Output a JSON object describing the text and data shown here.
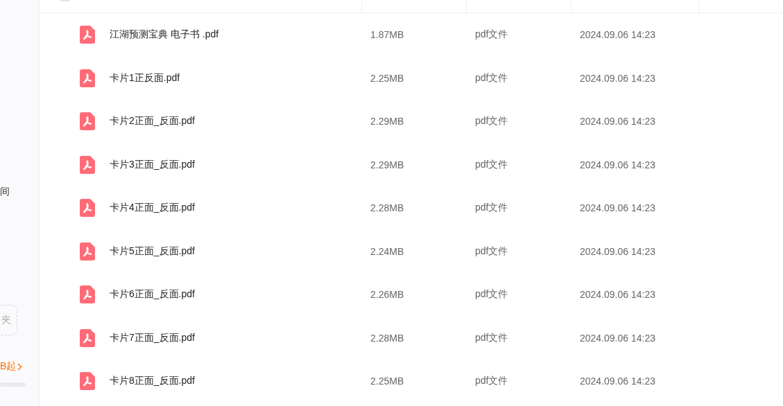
{
  "sidebar": {
    "items": [
      {
        "kind": "text",
        "label": "间"
      },
      {
        "kind": "dashed_button",
        "label": "夹"
      },
      {
        "kind": "link",
        "label": "B起"
      },
      {
        "kind": "meter"
      }
    ]
  },
  "header": {
    "select_all": {
      "checked": false
    }
  },
  "files": [
    {
      "name": "江湖预测宝典 电子书 .pdf",
      "size": "1.87MB",
      "type": "pdf文件",
      "modified": "2024.09.06 14:23"
    },
    {
      "name": "卡片1正反面.pdf",
      "size": "2.25MB",
      "type": "pdf文件",
      "modified": "2024.09.06 14:23"
    },
    {
      "name": "卡片2正面_反面.pdf",
      "size": "2.29MB",
      "type": "pdf文件",
      "modified": "2024.09.06 14:23"
    },
    {
      "name": "卡片3正面_反面.pdf",
      "size": "2.29MB",
      "type": "pdf文件",
      "modified": "2024.09.06 14:23"
    },
    {
      "name": "卡片4正面_反面.pdf",
      "size": "2.28MB",
      "type": "pdf文件",
      "modified": "2024.09.06 14:23"
    },
    {
      "name": "卡片5正面_反面.pdf",
      "size": "2.24MB",
      "type": "pdf文件",
      "modified": "2024.09.06 14:23"
    },
    {
      "name": "卡片6正面_反面.pdf",
      "size": "2.26MB",
      "type": "pdf文件",
      "modified": "2024.09.06 14:23"
    },
    {
      "name": "卡片7正面_反面.pdf",
      "size": "2.28MB",
      "type": "pdf文件",
      "modified": "2024.09.06 14:23"
    },
    {
      "name": "卡片8正面_反面.pdf",
      "size": "2.25MB",
      "type": "pdf文件",
      "modified": "2024.09.06 14:23"
    }
  ]
}
